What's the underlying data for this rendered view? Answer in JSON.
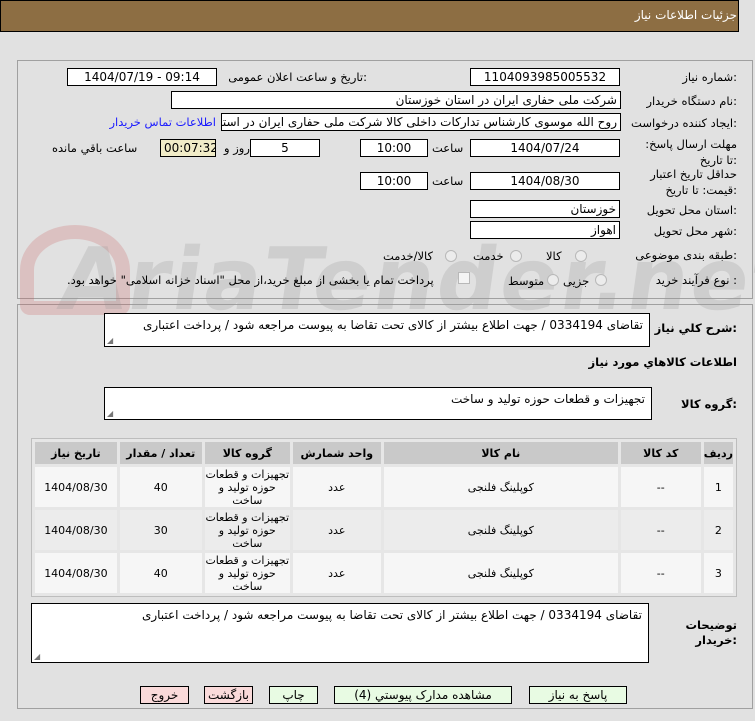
{
  "header": {
    "title": "جزئیات اطلاعات نیاز"
  },
  "watermark": "AriaTender.net",
  "form": {
    "need_number_label": "شماره نیاز:",
    "need_number": "1104093985005532",
    "announce_label": "تاریخ و ساعت اعلان عمومی:",
    "announce_value": "1404/07/19 - 09:14",
    "buyer_label": "نام دستگاه خریدار:",
    "buyer_value": "شرکت ملی حفاری ایران در استان خوزستان",
    "creator_label": "ایجاد کننده درخواست:",
    "creator_value": "روح الله موسوی کارشناس تدارکات داخلی کالا شرکت ملی حفاری ایران در استان",
    "contact_link": "اطلاعات تماس خریدار",
    "deadline_label": "مهلت ارسال پاسخ: تا تاریخ:",
    "deadline_date": "1404/07/24",
    "time_label": "ساعت",
    "deadline_time": "10:00",
    "days": "5",
    "days_label": "روز و",
    "remaining": "00:07:32",
    "remaining_label": "ساعت باقي مانده",
    "validity_label": "حداقل تاریخ اعتبار قیمت: تا تاریخ:",
    "validity_date": "1404/08/30",
    "validity_time": "10:00",
    "province_label": "استان محل تحویل:",
    "province": "خوزستان",
    "city_label": "شهر محل تحویل:",
    "city": "اهواز",
    "category_label": "طبقه بندی موضوعی:",
    "category_options": [
      "کالا",
      "خدمت",
      "کالا/خدمت"
    ],
    "process_label": "نوع فرآیند خرید :",
    "process_options": [
      "جزیی",
      "متوسط"
    ],
    "payment_note": "پرداخت تمام یا بخشی از مبلغ خرید،از محل \"اسناد خزانه اسلامی\" خواهد بود."
  },
  "details": {
    "summary_label": "شرح کلي نیاز:",
    "summary": "تقاضای    0334194   / جهت اطلاع بیشتر از کالای تحت تقاضا  به پیوست مراجعه شود / پرداخت اعتباری",
    "goods_title": "اطلاعات كالاهاي مورد نياز",
    "group_label": "گروه کالا:",
    "group_value": "تجهیزات و قطعات حوزه تولید و ساخت",
    "table": {
      "headers": [
        "ردیف",
        "کد کالا",
        "نام کالا",
        "واحد شمارش",
        "گروه کالا",
        "تعداد / مقدار",
        "تاریخ نیاز"
      ],
      "rows": [
        [
          "1",
          "--",
          "کوپلینگ فلنجی",
          "عدد",
          "تجهیزات و قطعات حوزه تولید و ساخت",
          "40",
          "1404/08/30"
        ],
        [
          "2",
          "--",
          "کوپلینگ فلنجی",
          "عدد",
          "تجهیزات و قطعات حوزه تولید و ساخت",
          "30",
          "1404/08/30"
        ],
        [
          "3",
          "--",
          "کوپلینگ فلنجی",
          "عدد",
          "تجهیزات و قطعات حوزه تولید و ساخت",
          "40",
          "1404/08/30"
        ]
      ]
    },
    "buyer_notes_label": "توضیحات خریدار:",
    "buyer_notes": "تقاضای    0334194   / جهت اطلاع بیشتر از کالای تحت تقاضا  به پیوست مراجعه شود / پرداخت اعتباری"
  },
  "buttons": {
    "reply": "پاسخ به نیاز",
    "attachments": "مشاهده مدارک پیوستي (4)",
    "print": "چاپ",
    "back": "بازگشت",
    "exit": "خروج"
  }
}
